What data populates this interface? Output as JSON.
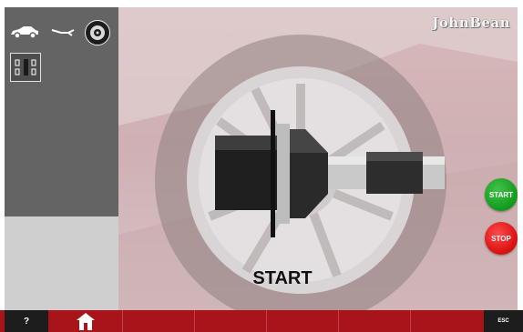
{
  "brand": {
    "logo_text": "JohnBean"
  },
  "left_panel": {
    "icons": [
      "car-icon",
      "wrench-icon",
      "wheel-icon",
      "balancer-mode-icon"
    ]
  },
  "main": {
    "status_text": "START",
    "start_button_label": "START",
    "stop_button_label": "STOP"
  },
  "bottom_bar": {
    "help_label": "?",
    "home_icon": "home-icon",
    "esc_label": "ESC"
  },
  "colors": {
    "accent_red": "#a9141b",
    "start_green": "#1aa324",
    "stop_red": "#e31414",
    "panel_dark": "#646464",
    "panel_light": "#cfcfcf"
  }
}
